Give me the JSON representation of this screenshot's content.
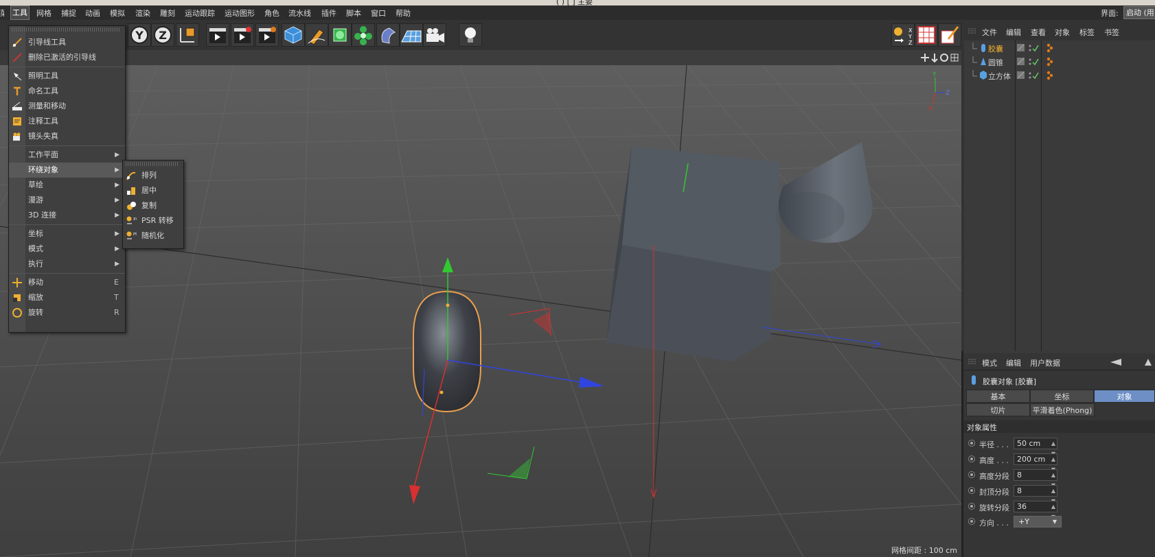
{
  "title_fragment": "(        )  [                ]  主要",
  "menubar": {
    "items": [
      "菜",
      "工具",
      "网格",
      "捕捉",
      "动画",
      "模拟",
      "渲染",
      "雕刻",
      "运动跟踪",
      "运动图形",
      "角色",
      "流水线",
      "插件",
      "脚本",
      "窗口",
      "帮助"
    ],
    "layout_label": "界面:",
    "layout_value": "启动 (用"
  },
  "toolbar": {
    "axis_y": "Y",
    "axis_z": "Z"
  },
  "tools_menu": {
    "items": {
      "guide": "引导线工具",
      "delete_guides": "删除已激活的引导线",
      "light": "照明工具",
      "naming": "命名工具",
      "measure": "测量和移动",
      "annotation": "注释工具",
      "lens": "镜头失真",
      "workplane": "工作平面",
      "arrange": "环绕对象",
      "sketch": "草绘",
      "navigate": "漫游",
      "connect3d": "3D 连接",
      "coords": "坐标",
      "modes": "模式",
      "execute": "执行",
      "move": "移动",
      "scale": "缩放",
      "rotate": "旋转"
    },
    "shortcuts": {
      "move": "E",
      "scale": "T",
      "rotate": "R"
    }
  },
  "submenu": {
    "items": [
      "排列",
      "居中",
      "复制",
      "PSR 转移",
      "随机化"
    ]
  },
  "viewport": {
    "grid_spacing": "网格间距 : 100 cm",
    "axis_labels": {
      "y": "Y",
      "z": "Z",
      "x": "X"
    }
  },
  "object_manager": {
    "menu": [
      "文件",
      "编辑",
      "查看",
      "对象",
      "标签",
      "书签"
    ],
    "objects": [
      {
        "name": "胶囊",
        "selected": true
      },
      {
        "name": "圆锥",
        "selected": false
      },
      {
        "name": "立方体",
        "selected": false
      }
    ]
  },
  "attributes": {
    "menu": [
      "模式",
      "编辑",
      "用户数据"
    ],
    "object_title": "胶囊对象 [胶囊]",
    "tabs": [
      "基本",
      "坐标",
      "对象",
      "切片",
      "平滑着色(Phong)"
    ],
    "selected_tab": "对象",
    "section": "对象属性",
    "props": [
      {
        "label": "半径 . . .",
        "value": "50 cm"
      },
      {
        "label": "高度 . . .",
        "value": "200 cm"
      },
      {
        "label": "高度分段",
        "value": "8"
      },
      {
        "label": "封顶分段",
        "value": "8"
      },
      {
        "label": "旋转分段",
        "value": "36"
      }
    ],
    "direction_label": "方向 . . .",
    "direction_value": "+Y"
  },
  "colors": {
    "accent_selected": "#6d8fc6",
    "selected_object_text": "#f0b030",
    "axis_x": "#e03030",
    "axis_y": "#30c030",
    "axis_z": "#3050e0"
  }
}
